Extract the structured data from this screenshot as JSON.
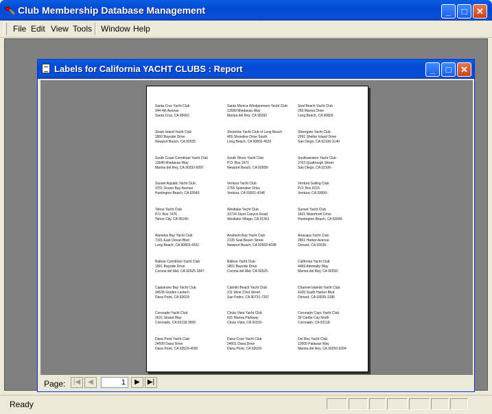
{
  "app": {
    "title": "Club Membership Database Management"
  },
  "menu": [
    "File",
    "Edit",
    "View",
    "Tools",
    "Window",
    "Help"
  ],
  "report": {
    "title": "Labels for California YACHT CLUBS : Report",
    "labels": [
      [
        "Santa Cruz Yacht Club",
        "244 4th Avenue",
        "Santa Cruz, CA 95062"
      ],
      [
        "Santa Monica Windjammers Yacht Club",
        "13589 Mindanao Way",
        "Marina del Rey, CA 90292"
      ],
      [
        "Seal Beach Yacht Club",
        "255 Marina Drive",
        "Long Beach, CA 90803"
      ],
      [
        "Shark Island Yacht Club",
        "1800 Bayside Drive",
        "Newport Beach, CA 92625"
      ],
      [
        "Shoreline Yacht Club of Long Beach",
        "455 Shoreline Drive South",
        "Long Beach, CA 90802-4526"
      ],
      [
        "Silvergate Yacht Club",
        "2091 Shelter Island Drive",
        "San Diego, CA 92106-3140"
      ],
      [
        "South Coast Corinthian Yacht Club",
        "13640 Mindanao Way",
        "Marina del Rey, CA 90292-6097"
      ],
      [
        "South Shore Yacht Club",
        "P.O. Box 1971",
        "Newport Beach, CA 92658-"
      ],
      [
        "Southwestern Yacht Club",
        "2702 Qualtrough Street",
        "San Diego, CA 92106-"
      ],
      [
        "Sunset Aquatic Yacht Club",
        "3701 Ocean Bay Avenue",
        "Huntington Beach, CA 92649"
      ],
      [
        "Ventura Yacht Club",
        "1755 Spinnaker Drive",
        "Ventura, CA 93001-4348"
      ],
      [
        "Ventura Sailing Club",
        "P.O. Box 6215",
        "Ventura, CA 93006-"
      ],
      [
        "Tahoe Yacht Club",
        "P.O. Box 7476",
        "Tahoe City, CA 96145-"
      ],
      [
        "Westlake Yacht Club",
        "31724 Stunt Canyon Road",
        "Westlake Village, CA 91361"
      ],
      [
        "Sunset Yacht Club",
        "1601 Waterfront Drive",
        "Huntington Beach, CA 92649"
      ],
      [
        "Alamitos Bay Yacht Club",
        "7101 East Ocean Blvd",
        "Long Beach, CA 90803-4331"
      ],
      [
        "Anaheim Bay Yacht Club",
        "2135 Seal Beach Street",
        "Newport Beach, CA 92663-4338"
      ],
      [
        "Anacapa Yacht Club",
        "2801 Harbor Avenue",
        "Oxnard, CA 93035-"
      ],
      [
        "Balboa Corinthian Yacht Club",
        "1801 Bayside Drive",
        "Corona del Mar, CA 92625-1847"
      ],
      [
        "Balboa Yacht Club",
        "1801 Bayside Drive",
        "Corona del Mar, CA 92625-"
      ],
      [
        "California Yacht Club",
        "4469 Admiralty Way",
        "Marina del Rey, CA 90292-"
      ],
      [
        "Capistrano Bay Yacht Club",
        "34535 Golden Lantern",
        "Dana Point, CA 92629-"
      ],
      [
        "Cabrillo Beach Yacht Club",
        "211 West 22nd Street",
        "San Pedro, CA 90731-7207"
      ],
      [
        "Channel Islands Yacht Club",
        "4100 South Harbor Blvd",
        "Oxnard, CA 93035-1286"
      ],
      [
        "Coronado Yacht Club",
        "1631 Strand Way",
        "Coronado, CA 92118-3005"
      ],
      [
        "Chula Vista Yacht Club",
        "631 Marina Parkway",
        "Chula Vista, CA 91910-"
      ],
      [
        "Coronado Cays Yacht Club",
        "30 Caribe Cay North",
        "Coronado, CA 92118-"
      ],
      [
        "Dana Point Yacht Club",
        "24500 Dana Drive",
        "Dana Point, CA 92629-4000"
      ],
      [
        "Dana Cove Yacht Club",
        "24601 Dana Drive",
        "Dana Point, CA 92629-"
      ],
      [
        "Del Rey Yacht Club",
        "13900 Palawan Way",
        "Marina del Rey, CA 90292-6204"
      ]
    ]
  },
  "navigation": {
    "page_label": "Page:",
    "current_page": "1",
    "first_icon": "first-page-icon",
    "prev_icon": "previous-page-icon",
    "next_icon": "next-page-icon",
    "last_icon": "last-page-icon"
  },
  "status": {
    "text": "Ready"
  },
  "colors": {
    "titlebar": "#0a5ee0",
    "workspace": "#808080",
    "close": "#c7441c"
  }
}
